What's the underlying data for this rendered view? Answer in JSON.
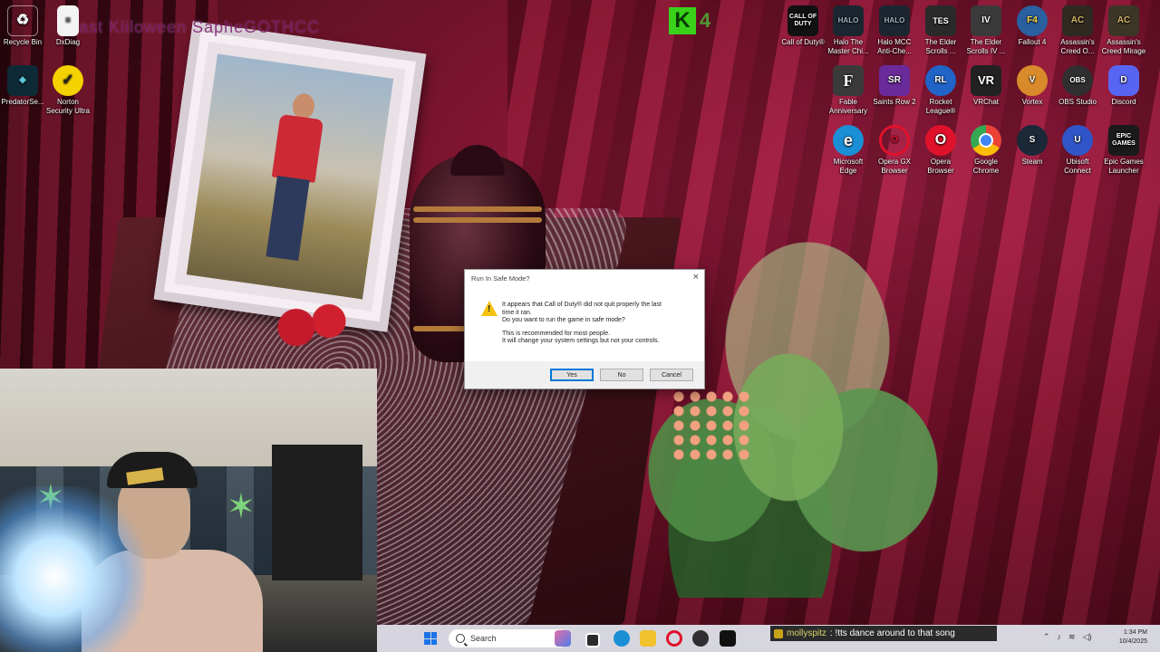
{
  "overlay_title": "Last Kliloween SapheGOTHCC",
  "desktop_left": [
    {
      "label": "Recycle Bin",
      "icon": "recycle-bin-icon"
    },
    {
      "label": "DxDiag",
      "icon": "document-icon"
    },
    {
      "label": "PredatorSe...",
      "icon": "predator-icon"
    },
    {
      "label": "Norton Security Ultra",
      "icon": "norton-icon"
    }
  ],
  "desktop_right": [
    {
      "label": "Call of Duty®",
      "icon": "call-of-duty-icon",
      "badge": "CALL OF DUTY",
      "color": "#111111"
    },
    {
      "label": "Halo The Master Chi...",
      "icon": "halo-icon",
      "badge": "HALO",
      "color": "#1c2630"
    },
    {
      "label": "Halo MCC Anti-Che...",
      "icon": "halo-mcc-icon",
      "badge": "HALO",
      "color": "#1c2630"
    },
    {
      "label": "The Elder Scrolls ...",
      "icon": "elder-scrolls-icon",
      "badge": "TES",
      "color": "#2a2a2a"
    },
    {
      "label": "The Elder Scrolls IV ...",
      "icon": "oblivion-icon",
      "badge": "IV",
      "color": "#3a3a3a"
    },
    {
      "label": "Fallout 4",
      "icon": "fallout-icon",
      "badge": "F4",
      "color": "#2a5fa0"
    },
    {
      "label": "Assassin's Creed O...",
      "icon": "assassins-creed-icon",
      "badge": "AC",
      "color": "#2e2a22"
    },
    {
      "label": "Assassin's Creed Mirage",
      "icon": "assassins-creed-mirage-icon",
      "badge": "AC",
      "color": "#3b3626"
    },
    {
      "label": "Fable Anniversary",
      "icon": "fable-icon",
      "badge": "F",
      "color": "#3a3a3a"
    },
    {
      "label": "Saints Row 2",
      "icon": "saints-row-icon",
      "badge": "SR",
      "color": "#6a2a9a"
    },
    {
      "label": "Rocket League®",
      "icon": "rocket-league-icon",
      "badge": "RL",
      "color": "#2064c8"
    },
    {
      "label": "VRChat",
      "icon": "vrchat-icon",
      "badge": "VR",
      "color": "#222222"
    },
    {
      "label": "Vortex",
      "icon": "vortex-icon",
      "badge": "V",
      "color": "#d98a2a"
    },
    {
      "label": "OBS Studio",
      "icon": "obs-icon",
      "badge": "OBS",
      "color": "#302e31"
    },
    {
      "label": "Discord",
      "icon": "discord-icon",
      "badge": "D",
      "color": "#5865f2"
    },
    {
      "label": "Microsoft Edge",
      "icon": "edge-icon",
      "badge": "e",
      "color": "#1a8fd6"
    },
    {
      "label": "Opera GX Browser",
      "icon": "opera-gx-icon",
      "badge": "O",
      "color": "#e0112b"
    },
    {
      "label": "Opera Browser",
      "icon": "opera-icon",
      "badge": "O",
      "color": "#e0112b"
    },
    {
      "label": "Google Chrome",
      "icon": "chrome-icon",
      "badge": "G",
      "color": "#34a853"
    },
    {
      "label": "Steam",
      "icon": "steam-icon",
      "badge": "S",
      "color": "#1b2838"
    },
    {
      "label": "Ubisoft Connect",
      "icon": "ubisoft-icon",
      "badge": "U",
      "color": "#3055c8"
    },
    {
      "label": "Epic Games Launcher",
      "icon": "epic-games-icon",
      "badge": "EPIC GAMES",
      "color": "#1a1a1a"
    }
  ],
  "kick_overlay": {
    "letter": "K",
    "number": "4"
  },
  "dialog": {
    "title": "Run In Safe Mode?",
    "line1": "It appears that Call of Duty® did not quit properly the last",
    "line2": "time it ran.",
    "line3": "Do you want to run the game in safe mode?",
    "line4": "This is recommended for most people.",
    "line5": "It will change your system settings but not your controls.",
    "yes": "Yes",
    "no": "No",
    "cancel": "Cancel"
  },
  "taskbar": {
    "search_placeholder": "Search",
    "chat_user": "mollyspitz",
    "chat_message": ": !tts dance around to that song",
    "time": "1:34 PM",
    "date": "10/4/2025"
  }
}
